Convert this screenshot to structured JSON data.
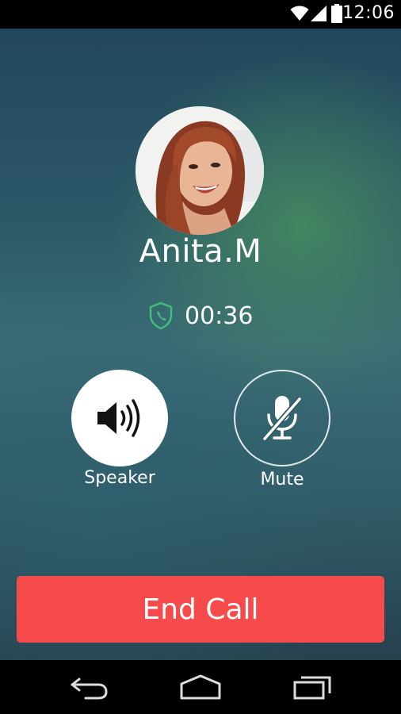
{
  "status_bar": {
    "time": "12:06",
    "icons": [
      "wifi-icon",
      "signal-icon",
      "battery-icon"
    ]
  },
  "call": {
    "caller_name": "Anita.M",
    "duration": "00:36",
    "secure_icon": "shield-phone-icon"
  },
  "actions": {
    "speaker_label": "Speaker",
    "speaker_icon": "speaker-icon",
    "mute_label": "Mute",
    "mute_icon": "mic-off-icon"
  },
  "end_call": {
    "label": "End Call",
    "color": "#f74a4a"
  },
  "nav": {
    "icons": [
      "back-icon",
      "home-icon",
      "recents-icon"
    ]
  },
  "colors": {
    "accent_green": "#3fbf7a",
    "end_call_red": "#f74a4a"
  }
}
